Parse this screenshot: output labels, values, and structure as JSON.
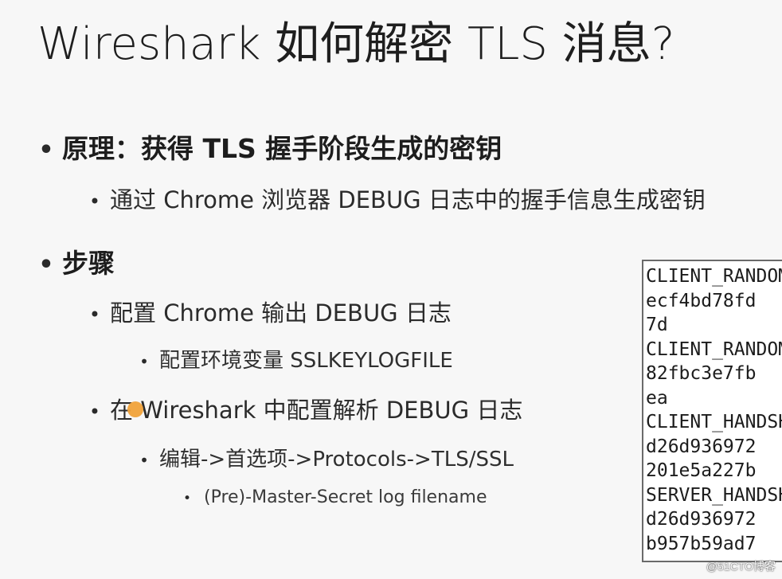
{
  "slide": {
    "title": "Wireshark 如何解密 TLS 消息?",
    "bullets": [
      {
        "text": "原理：获得 TLS 握手阶段生成的密钥"
      },
      {
        "text": "通过 Chrome 浏览器 DEBUG 日志中的握手信息生成密钥"
      },
      {
        "text": "步骤"
      },
      {
        "text": "配置 Chrome 输出 DEBUG 日志"
      },
      {
        "text": "配置环境变量 SSLKEYLOGFILE"
      },
      {
        "text": "在 Wireshark 中配置解析 DEBUG 日志"
      },
      {
        "text": "编辑->首选项->Protocols->TLS/SSL"
      },
      {
        "text": "(Pre)-Master-Secret log filename"
      }
    ],
    "bullet_symbol": "•"
  },
  "code_box": {
    "lines": [
      "CLIENT_RANDOM",
      "ecf4bd78fd",
      "7d",
      "CLIENT_RANDOM",
      "82fbc3e7fb",
      "ea",
      "CLIENT_HANDSHAKE",
      "d26d936972",
      "201e5a227b",
      "SERVER_HANDSHAKE",
      "d26d936972",
      "b957b59ad7"
    ]
  },
  "watermark": "@51CTO博客",
  "colors": {
    "background": "#f7f7f7",
    "cursor": "#f0a23a",
    "code_border": "#6a6a6a"
  }
}
